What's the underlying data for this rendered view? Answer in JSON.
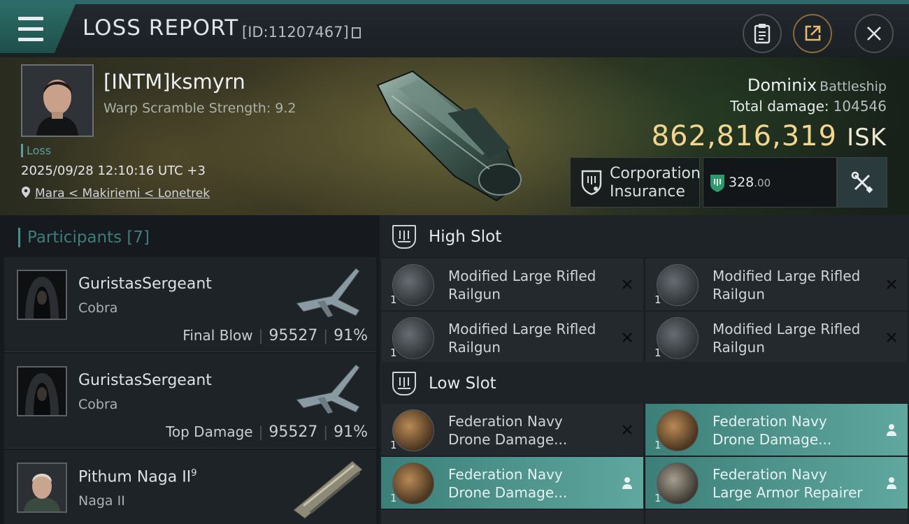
{
  "header": {
    "title": "LOSS REPORT",
    "report_id": "[ID:11207467]"
  },
  "victim": {
    "name": "[INTM]ksmyrn",
    "warp_scramble": "Warp Scramble Strength: 9.2",
    "loss_label": "Loss",
    "datetime": "2025/09/28 12:10:16 UTC +3",
    "location": "Mara < Makiriemi < Lonetrek"
  },
  "ship": {
    "name": "Dominix",
    "class": "Battleship",
    "total_damage_label": "Total damage:",
    "total_damage": "104546",
    "isk_value": "862,816,319",
    "isk_unit": "ISK"
  },
  "insurance": {
    "label_line1": "Corporation",
    "label_line2": "Insurance",
    "value_main": "328",
    "value_dec": ".00"
  },
  "participants": {
    "header": "Participants [7]",
    "rows": [
      {
        "name": "GuristasSergeant",
        "ship": "Cobra",
        "role": "Final Blow",
        "damage": "95527",
        "pct": "91%"
      },
      {
        "name": "GuristasSergeant",
        "ship": "Cobra",
        "role": "Top Damage",
        "damage": "95527",
        "pct": "91%"
      },
      {
        "name": "Pithum Naga II",
        "name_sup": "9",
        "ship": "Naga II"
      }
    ]
  },
  "slots": {
    "high": {
      "title": "High Slot",
      "modules": [
        {
          "qty": "1",
          "line1": "Modified Large Rifled",
          "line2": "Railgun"
        },
        {
          "qty": "1",
          "line1": "Modified Large Rifled",
          "line2": "Railgun"
        },
        {
          "qty": "1",
          "line1": "Modified Large Rifled",
          "line2": "Railgun"
        },
        {
          "qty": "1",
          "line1": "Modified Large Rifled",
          "line2": "Railgun"
        }
      ]
    },
    "low": {
      "title": "Low Slot",
      "modules": [
        {
          "qty": "1",
          "line1": "Federation Navy",
          "line2": "Drone Damage..."
        },
        {
          "qty": "1",
          "line1": "Federation Navy",
          "line2": "Drone Damage..."
        },
        {
          "qty": "1",
          "line1": "Federation Navy",
          "line2": "Drone Damage..."
        },
        {
          "qty": "1",
          "line1": "Federation Navy",
          "line2": "Large Armor Repairer"
        }
      ]
    }
  },
  "colors": {
    "accent_teal": "#3c7f79",
    "isk_gold": "#f2d58e",
    "participants_header": "#3f7c7c"
  },
  "icons": [
    "menu-icon",
    "clipboard-icon",
    "share-icon",
    "close-icon",
    "location-pin-icon",
    "insurance-shield-icon",
    "insurance-badge-icon",
    "wrench-icon",
    "high-slot-icon",
    "low-slot-icon",
    "dropped-x-icon",
    "owner-person-icon"
  ]
}
